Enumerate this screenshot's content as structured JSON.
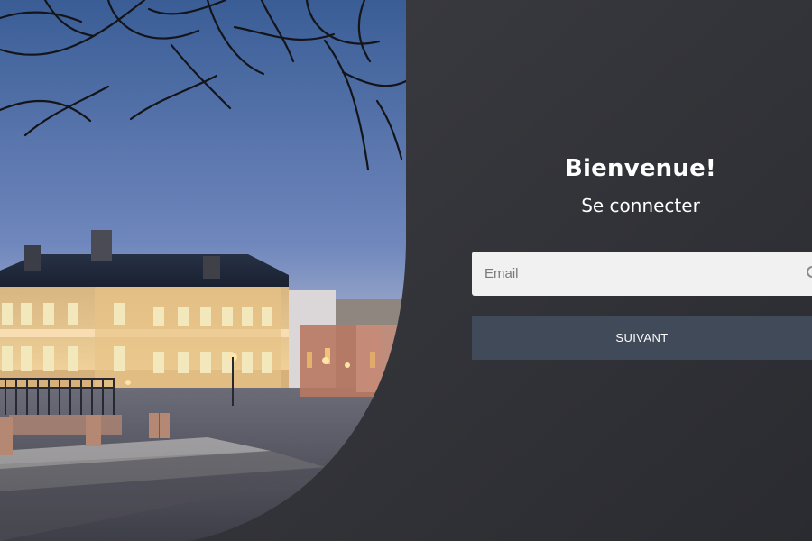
{
  "auth": {
    "title": "Bienvenue!",
    "subtitle": "Se connecter",
    "email_placeholder": "Email",
    "next_label": "SUIVANT"
  }
}
